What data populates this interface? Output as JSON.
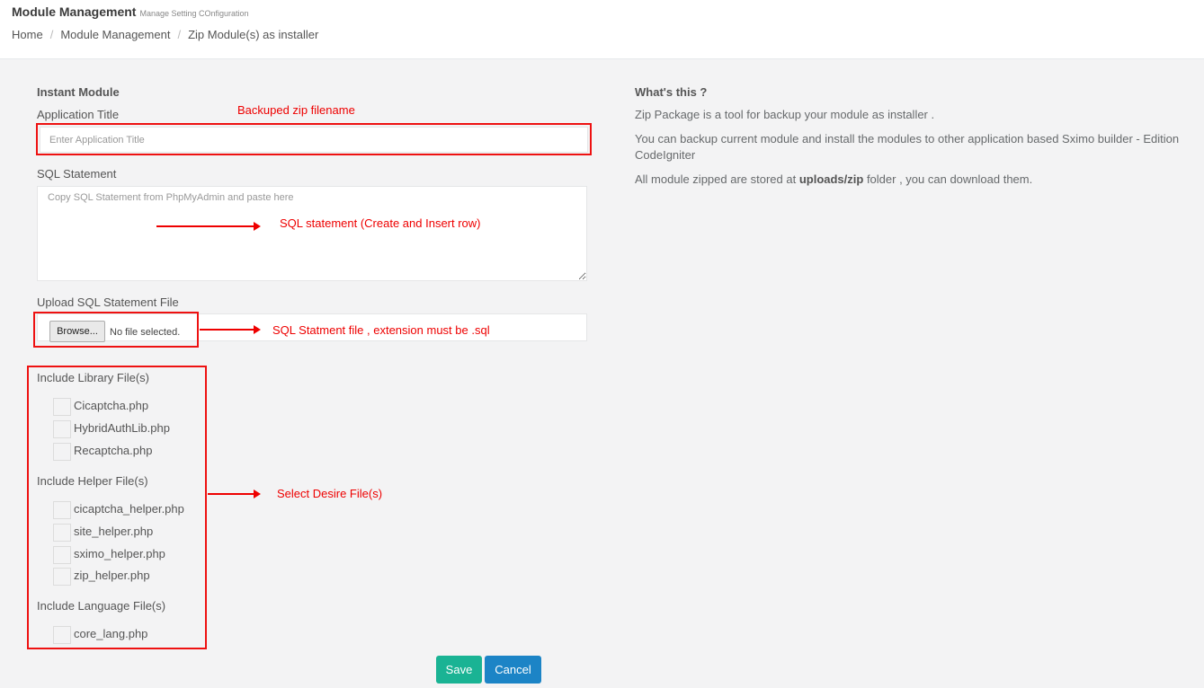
{
  "header": {
    "title": "Module Management",
    "subtitle": "Manage Setting COnfiguration",
    "breadcrumb": [
      "Home",
      "Module Management",
      "Zip Module(s) as installer"
    ]
  },
  "form": {
    "section_title": "Instant Module",
    "app_title_label": "Application Title",
    "app_title_placeholder": "Enter Application Title",
    "sql_label": "SQL Statement",
    "sql_placeholder": "Copy SQL Statement from PhpMyAdmin and paste here",
    "upload_label": "Upload SQL Statement File",
    "browse_label": "Browse...",
    "file_status": "No file selected.",
    "library_title": "Include Library File(s)",
    "library_files": [
      "Cicaptcha.php",
      "HybridAuthLib.php",
      "Recaptcha.php"
    ],
    "helper_title": "Include Helper File(s)",
    "helper_files": [
      "cicaptcha_helper.php",
      "site_helper.php",
      "sximo_helper.php",
      "zip_helper.php"
    ],
    "language_title": "Include Language File(s)",
    "language_files": [
      "core_lang.php"
    ],
    "save_label": "Save",
    "cancel_label": "Cancel"
  },
  "annotations": {
    "zip_filename": "Backuped zip filename",
    "sql_statement": "SQL statement (Create and Insert row)",
    "sql_file": "SQL Statment file , extension must be .sql",
    "select_files": "Select Desire File(s)"
  },
  "help": {
    "title": "What's this ?",
    "p1": "Zip Package is a tool for backup your module as installer .",
    "p2": "You can backup current module and install the modules to other application based Sximo builder - Edition CodeIgniter",
    "p3_pre": "All module zipped are stored at ",
    "p3_bold": "uploads/zip",
    "p3_post": " folder , you can download them."
  },
  "colors": {
    "save": "#1ab394",
    "cancel": "#1c84c6",
    "annotation": "#ee0000"
  }
}
